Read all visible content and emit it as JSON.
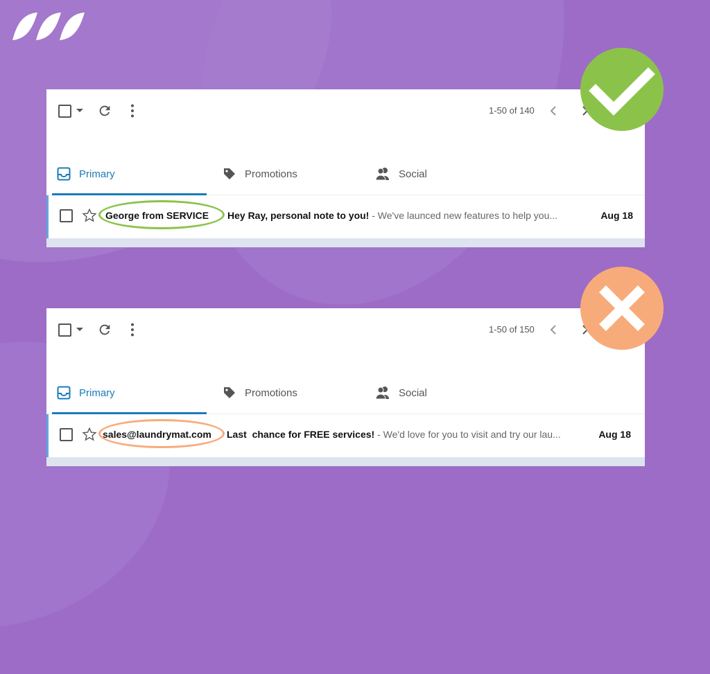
{
  "branding": {
    "logo": "brand-stripes-logo"
  },
  "colors": {
    "background": "#9d6cc7",
    "accent_blue": "#1a7bb8",
    "good_green": "#8bc34a",
    "bad_orange": "#f8ab7a"
  },
  "examples": [
    {
      "verdict": "good",
      "verdict_icon": "checkmark-icon",
      "toolbar": {
        "count": "1-50 of 140"
      },
      "tabs": [
        {
          "label": "Primary",
          "icon": "inbox-icon",
          "active": true
        },
        {
          "label": "Promotions",
          "icon": "tag-icon",
          "active": false
        },
        {
          "label": "Social",
          "icon": "people-icon",
          "active": false
        }
      ],
      "email": {
        "sender": "George from SERVICE",
        "subject": "Hey Ray, personal note to you!",
        "snippet": " - We've launced new features to help you...",
        "date": "Aug 18"
      }
    },
    {
      "verdict": "bad",
      "verdict_icon": "cross-icon",
      "toolbar": {
        "count": "1-50 of 150"
      },
      "tabs": [
        {
          "label": "Primary",
          "icon": "inbox-icon",
          "active": true
        },
        {
          "label": "Promotions",
          "icon": "tag-icon",
          "active": false
        },
        {
          "label": "Social",
          "icon": "people-icon",
          "active": false
        }
      ],
      "email": {
        "sender": "sales@laundrymat.com",
        "subject": "Last  chance for FREE services!",
        "snippet": " - We'd love for you to visit and try our lau...",
        "date": "Aug 18"
      }
    }
  ]
}
